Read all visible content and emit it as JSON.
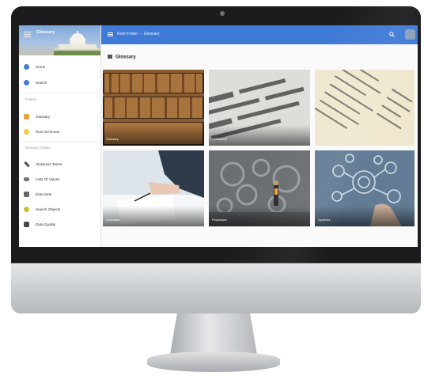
{
  "app": {
    "brand": "Glossary",
    "breadcrumb": [
      "Root Folder",
      "Glossary"
    ],
    "page_heading": "Glossary"
  },
  "sidebar": {
    "items": [
      {
        "label": "Home",
        "icon": "home-icon",
        "color": "#3f7ad6"
      },
      {
        "label": "Search",
        "icon": "search-icon",
        "color": "#3f7ad6"
      }
    ],
    "section_folders": "Folders",
    "folders": [
      {
        "label": "Glossary",
        "icon": "folder-icon",
        "color": "#e8a33a"
      },
      {
        "label": "Root Schemas",
        "icon": "folder-icon",
        "color": "#f2c94c"
      }
    ],
    "section_glossary": "Glossary Folders",
    "glossary_items": [
      {
        "label": "Business Terms",
        "icon": "wrench-icon",
        "color": "#4a4a4a"
      },
      {
        "label": "Lists Of Values",
        "icon": "list-icon",
        "color": "#777777"
      },
      {
        "label": "Data Sets",
        "icon": "dataset-icon",
        "color": "#666666"
      },
      {
        "label": "Search Objects",
        "icon": "object-icon",
        "color": "#c9c23a"
      },
      {
        "label": "Data Quality",
        "icon": "quality-icon",
        "color": "#444444"
      }
    ]
  },
  "tiles": [
    {
      "title": "Glossary",
      "subtitle": "",
      "image": "bookshelf-image"
    },
    {
      "title": "Definitions",
      "subtitle": "",
      "image": "dictionary-image"
    },
    {
      "title": "",
      "subtitle": "",
      "image": "index-list-image"
    },
    {
      "title": "Contracts",
      "subtitle": "",
      "image": "signing-document-image"
    },
    {
      "title": "Processes",
      "subtitle": "",
      "image": "gears-person-image"
    },
    {
      "title": "Systems",
      "subtitle": "",
      "image": "digital-network-image"
    }
  ],
  "colors": {
    "topbar": "#3f7ad6",
    "bezel": "#1c1c1e",
    "accent_folder": "#e8a33a"
  }
}
